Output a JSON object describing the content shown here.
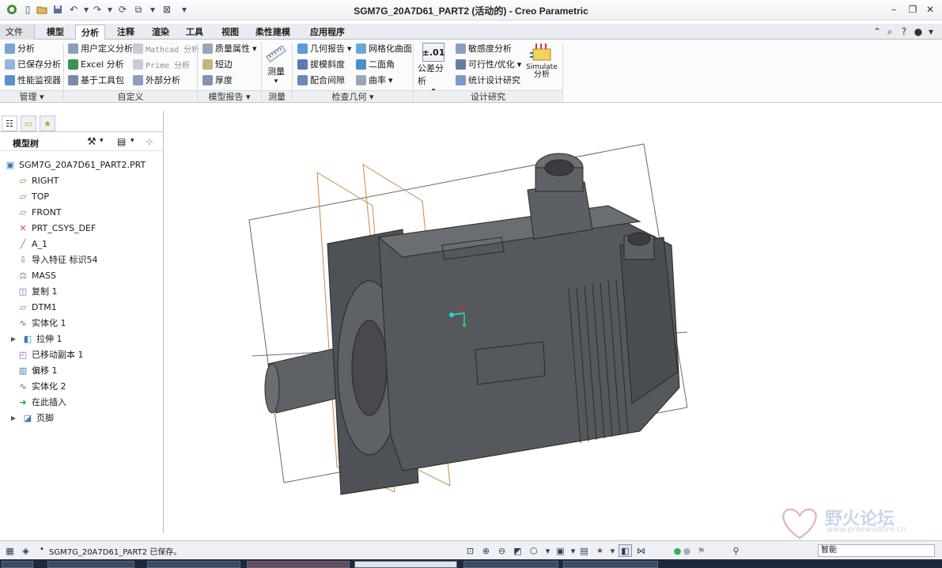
{
  "window": {
    "title": "SGM7G_20A7D61_PART2 (活动的) - Creo Parametric"
  },
  "tabs": [
    {
      "label": "文件"
    },
    {
      "label": "模型"
    },
    {
      "label": "分析"
    },
    {
      "label": "注释"
    },
    {
      "label": "渲染"
    },
    {
      "label": "工具"
    },
    {
      "label": "视图"
    },
    {
      "label": "柔性建模"
    },
    {
      "label": "应用程序"
    }
  ],
  "ribbon": {
    "manage": {
      "items": [
        "分析",
        "已保存分析",
        "性能监视器"
      ],
      "group": "管理"
    },
    "custom": {
      "items": [
        "用户定义分析",
        "Excel 分析",
        "基于工具包",
        "Mathcad 分析",
        "Prime 分析",
        "外部分析"
      ],
      "group": "自定义"
    },
    "model_report": {
      "items": [
        "质量属性",
        "短边",
        "厚度"
      ],
      "group": "模型报告"
    },
    "measure": {
      "label": "测量",
      "group": "测量"
    },
    "inspect": {
      "items": [
        "几何报告",
        "拔模斜度",
        "配合间隙",
        "网格化曲面",
        "二面角",
        "曲率"
      ],
      "group": "检查几何"
    },
    "design": {
      "tolerance_label": "公差分析",
      "tolerance_icon": "±.01",
      "items": [
        "敏感度分析",
        "可行性/优化",
        "统计设计研究"
      ],
      "simulate_line1": "Simulate",
      "simulate_line2": "分析",
      "group": "设计研究"
    }
  },
  "model_tree": {
    "header": "模型树",
    "items": [
      {
        "label": "SGM7G_20A7D61_PART2.PRT",
        "icon": "part-icon"
      },
      {
        "label": "RIGHT",
        "icon": "datum-plane-icon"
      },
      {
        "label": "TOP",
        "icon": "datum-plane-icon"
      },
      {
        "label": "FRONT",
        "icon": "datum-plane-icon"
      },
      {
        "label": "PRT_CSYS_DEF",
        "icon": "csys-icon"
      },
      {
        "label": "A_1",
        "icon": "axis-icon"
      },
      {
        "label": "导入特征 标识54",
        "icon": "import-icon"
      },
      {
        "label": "MASS",
        "icon": "mass-icon"
      },
      {
        "label": "复制 1",
        "icon": "copy-icon"
      },
      {
        "label": "DTM1",
        "icon": "datum-plane-icon"
      },
      {
        "label": "实体化 1",
        "icon": "solidify-icon"
      },
      {
        "label": "拉伸 1",
        "icon": "extrude-icon"
      },
      {
        "label": "已移动副本 1",
        "icon": "moved-copy-icon"
      },
      {
        "label": "偏移 1",
        "icon": "offset-icon"
      },
      {
        "label": "实体化 2",
        "icon": "solidify-icon"
      },
      {
        "label": "在此插入",
        "icon": "insert-arrow-icon"
      },
      {
        "label": "页脚",
        "icon": "footer-icon"
      }
    ]
  },
  "status": {
    "message": "SGM7G_20A7D61_PART2 已保存。",
    "filter": "智能"
  },
  "watermark": {
    "title": "野火论坛",
    "url": "www.proewildfire.cn"
  },
  "colors": {
    "accent": "#2f6db5",
    "model": "#55585c",
    "datum_plane_orange": "#c98a4a"
  }
}
